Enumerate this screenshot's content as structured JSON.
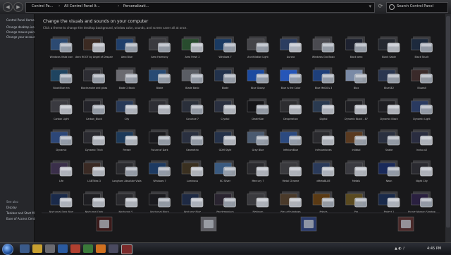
{
  "window": {
    "back_glyph": "◀",
    "forward_glyph": "▶",
    "breadcrumbs": [
      "Control Pa...",
      "All Control Panel It...",
      "Personalizati..."
    ],
    "search_placeholder": "Search Control Panel",
    "refresh_glyph": "⟳"
  },
  "sidebar": {
    "items": [
      "Control Panel Home",
      "Change desktop icons",
      "Change mouse pointers",
      "Change your account picture"
    ],
    "see_also": [
      "See also",
      "Display",
      "Taskbar and Start Menu",
      "Ease of Access Center"
    ]
  },
  "main": {
    "heading": "Change the visuals and sounds on your computer",
    "subheading": "Click a theme to change the desktop background, window color, sounds, and screen saver all at once."
  },
  "themes": [
    {
      "name": "Windows Vista Icon",
      "c": "#2c4a72",
      "glass": false
    },
    {
      "name": "Aero ROOT by Angel of Despair",
      "c": "#3b2a22",
      "glass": true
    },
    {
      "name": "Aero Blue",
      "c": "#1f3f6b",
      "glass": false
    },
    {
      "name": "Aero Harmony",
      "c": "#3a3a3f",
      "glass": false
    },
    {
      "name": "Aero Fresh 2",
      "c": "#284c2e",
      "glass": true
    },
    {
      "name": "Windows 7",
      "c": "#1a3a62",
      "glass": false
    },
    {
      "name": "Annihilation Light",
      "c": "#444448",
      "glass": false
    },
    {
      "name": "Aurora",
      "c": "#2b3d60",
      "glass": true
    },
    {
      "name": "Windows Gra Basic",
      "c": "#4a4a50",
      "glass": false
    },
    {
      "name": "Black aero",
      "c": "#1e2230",
      "glass": false
    },
    {
      "name": "Black Sable",
      "c": "#252830",
      "glass": true
    },
    {
      "name": "Black Touch",
      "c": "#1d2a3d",
      "glass": false
    },
    {
      "name": "BlackBlue era",
      "c": "#1f4460",
      "glass": false
    },
    {
      "name": "Blacksmoke and glass",
      "c": "#2d2d33",
      "glass": false
    },
    {
      "name": "Blade 2 Basic",
      "c": "#6a6a70",
      "glass": false
    },
    {
      "name": "Blade",
      "c": "#274a74",
      "glass": false
    },
    {
      "name": "Blade Basic",
      "c": "#5a5d64",
      "glass": false
    },
    {
      "name": "Blade",
      "c": "#22324c",
      "glass": false
    },
    {
      "name": "Blue Glossy",
      "c": "#1b4aa0",
      "glass": false
    },
    {
      "name": "Blue is the Color",
      "c": "#2656b8",
      "glass": false
    },
    {
      "name": "Blue MeDiCs 3",
      "c": "#1e3f7a",
      "glass": false
    },
    {
      "name": "Blux",
      "c": "#7a8aa6",
      "glass": false
    },
    {
      "name": "BlueSE2",
      "c": "#2a3650",
      "glass": false
    },
    {
      "name": "Bluwall",
      "c": "#3a2a2a",
      "glass": false
    },
    {
      "name": "Carbon Light",
      "c": "#3a3a40",
      "glass": true
    },
    {
      "name": "Carbon_Black",
      "c": "#24242a",
      "glass": false
    },
    {
      "name": "City",
      "c": "#283a58",
      "glass": true
    },
    {
      "name": "",
      "c": "#2e2e34",
      "glass": true
    },
    {
      "name": "Concave 7",
      "c": "#2a2f3a",
      "glass": false
    },
    {
      "name": "Crystal",
      "c": "#2a3040",
      "glass": true
    },
    {
      "name": "DeathStar",
      "c": "#151518",
      "glass": false
    },
    {
      "name": "Desperation",
      "c": "#2d2d30",
      "glass": true
    },
    {
      "name": "Digital",
      "c": "#2a3a50",
      "glass": true
    },
    {
      "name": "Dynamic Black - 87",
      "c": "#202024",
      "glass": true
    },
    {
      "name": "Dynamic Black",
      "c": "#1f1f23",
      "glass": true
    },
    {
      "name": "Dynamic Light",
      "c": "#2a3a60",
      "glass": false
    },
    {
      "name": "Dynamic",
      "c": "#2d4778",
      "glass": false
    },
    {
      "name": "Dynamic Thick",
      "c": "#2a2a30",
      "glass": true
    },
    {
      "name": "Freeze",
      "c": "#1d3a5a",
      "glass": true
    },
    {
      "name": "Future of Dark",
      "c": "#1a1a1e",
      "glass": false
    },
    {
      "name": "Geometrix",
      "c": "#2a3040",
      "glass": false
    },
    {
      "name": "GDM Style",
      "c": "#25324a",
      "glass": true
    },
    {
      "name": "Gray Blue",
      "c": "#4a5a70",
      "glass": false
    },
    {
      "name": "InfiniumBlue",
      "c": "#2c4a80",
      "glass": false
    },
    {
      "name": "Infiniumtones",
      "c": "#2a2a2e",
      "glass": true
    },
    {
      "name": "Inlikkal",
      "c": "#5a3a20",
      "glass": false
    },
    {
      "name": "Snake",
      "c": "#2a3040",
      "glass": false
    },
    {
      "name": "Invisu x2",
      "c": "#2a2d40",
      "glass": true
    },
    {
      "name": "Life",
      "c": "#3a2f4a",
      "glass": true
    },
    {
      "name": "LGBTNex.3",
      "c": "#3a2a24",
      "glass": true
    },
    {
      "name": "Longhorn Absolute Vista",
      "c": "#2a2a2e",
      "glass": false
    },
    {
      "name": "Windows 7",
      "c": "#1d3a62",
      "glass": false
    },
    {
      "name": "Luminous",
      "c": "#3a3020",
      "glass": true
    },
    {
      "name": "KC Silver",
      "c": "#3a5a80",
      "glass": false
    },
    {
      "name": "Mercury 7",
      "c": "#2a2a2e",
      "glass": true
    },
    {
      "name": "Metal Chrome",
      "c": "#3a3a3e",
      "glass": true
    },
    {
      "name": "dMetaBLUE",
      "c": "#2a3a5a",
      "glass": true
    },
    {
      "name": "Metals",
      "c": "#3a3a40",
      "glass": true
    },
    {
      "name": "Neon",
      "c": "#1a2a5a",
      "glass": false
    },
    {
      "name": "Night City",
      "c": "#2a2a30",
      "glass": true
    },
    {
      "name": "Nocturnal Dark Blue",
      "c": "#1a2a4a",
      "glass": true
    },
    {
      "name": "Nocturnal Dark",
      "c": "#1e1e22",
      "glass": true
    },
    {
      "name": "Nocturnal S...",
      "c": "#2a2a2e",
      "glass": true
    },
    {
      "name": "Nocturnal Black",
      "c": "#1a1a1e",
      "glass": false
    },
    {
      "name": "Nocturne Blue",
      "c": "#1e2a44",
      "glass": true
    },
    {
      "name": "Pandemonium",
      "c": "#2a2430",
      "glass": false
    },
    {
      "name": "Platinum",
      "c": "#3a3a3e",
      "glass": true
    },
    {
      "name": "Play off shadows",
      "c": "#4a3a2a",
      "glass": true
    },
    {
      "name": "Polaris",
      "c": "#5a3a14",
      "glass": false
    },
    {
      "name": "Pro",
      "c": "#5a4a20",
      "glass": false
    },
    {
      "name": "Project 2",
      "c": "#1a2a4a",
      "glass": true
    },
    {
      "name": "Purple Maroon Shadow",
      "c": "#2a2040",
      "glass": false
    }
  ],
  "bottom_row": [
    {
      "label": "",
      "c": "#3a1a1a"
    },
    {
      "label": "",
      "c": "#5a5a60"
    },
    {
      "label": "",
      "c": "#2a3a6a"
    },
    {
      "label": "",
      "c": "#4a2a2a"
    }
  ],
  "taskbar": {
    "clock": "4:45 PM",
    "tray": "▲ ◐ ♪"
  }
}
